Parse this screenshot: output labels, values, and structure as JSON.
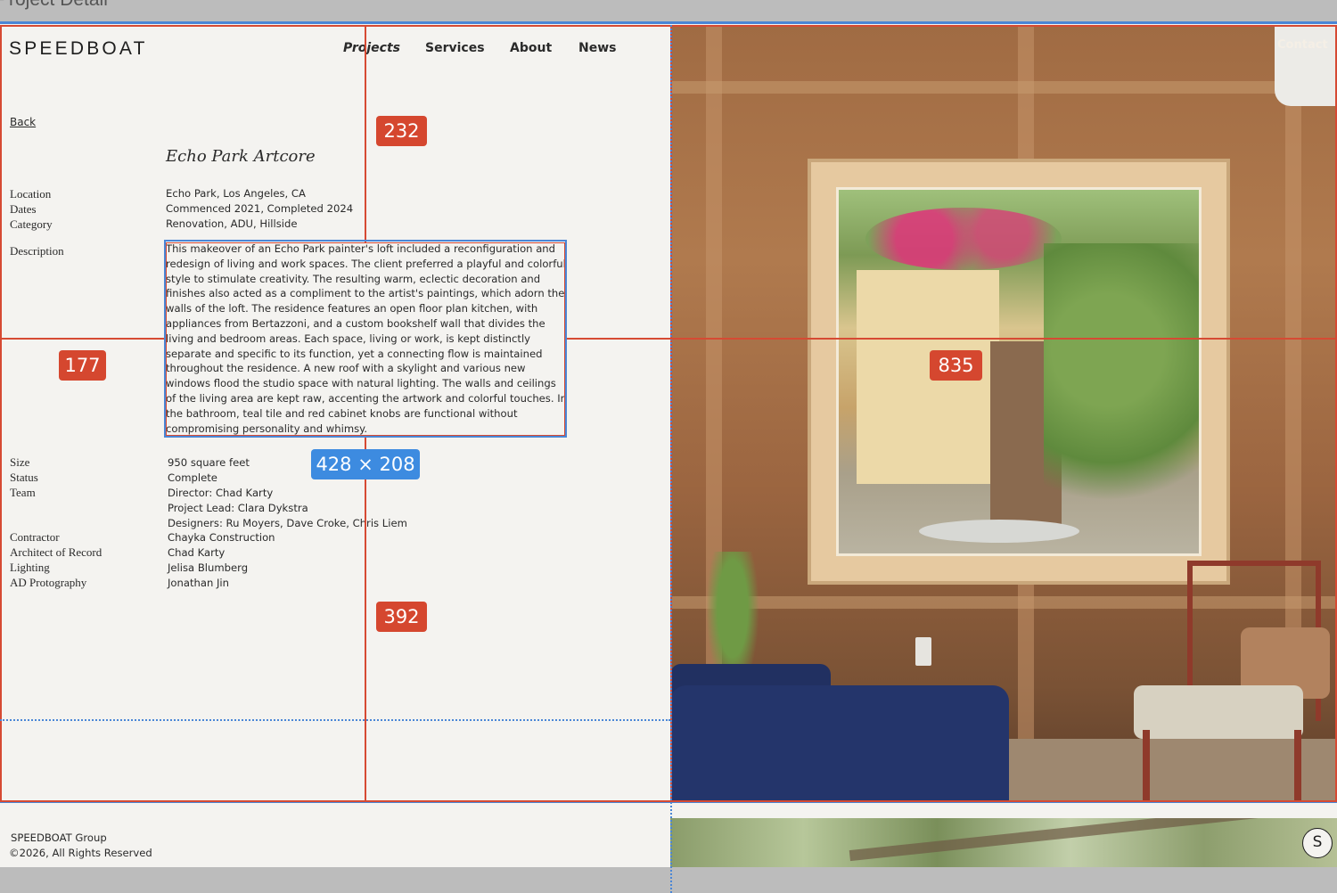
{
  "window": {
    "title": "Project Detail"
  },
  "brand": {
    "logo": "SPEEDBOAT"
  },
  "nav": {
    "projects": "Projects",
    "services": "Services",
    "about": "About",
    "news": "News",
    "contact": "Contact"
  },
  "project": {
    "back": "Back",
    "title": "Echo Park Artcore",
    "labels": {
      "location": "Location",
      "dates": "Dates",
      "category": "Category",
      "description": "Description",
      "size": "Size",
      "status": "Status",
      "team": "Team",
      "contractor": "Contractor",
      "architect": "Architect of Record",
      "lighting": "Lighting",
      "photography": "AD Protography"
    },
    "values": {
      "location": "Echo Park, Los Angeles, CA",
      "dates": "Commenced 2021, Completed 2024",
      "category": "Renovation, ADU, Hillside",
      "size": "950 square feet",
      "status": "Complete",
      "team": [
        "Director: Chad Karty",
        "Project Lead: Clara Dykstra",
        "Designers: Ru Moyers, Dave Croke, Chris Liem"
      ],
      "contractor": "Chayka Construction",
      "architect": "Chad Karty",
      "lighting": "Jelisa Blumberg",
      "photography": "Jonathan Jin"
    },
    "description_lines": [
      "This makeover of an Echo Park painter's loft included a reconfiguration and",
      "redesign of living and work spaces. The client preferred a playful and colorful",
      "style to stimulate creativity. The resulting warm, eclectic decoration and",
      "finishes also acted as a compliment to the artist's paintings, which adorn the",
      "walls of the loft. The residence features an open floor plan kitchen, with",
      "appliances from Bertazzoni, and a custom bookshelf wall that divides the",
      "living and bedroom areas. Each space, living or work, is kept distinctly",
      "separate and specific to its function, yet a connecting flow is maintained",
      "throughout the residence. A new roof with a skylight and various new",
      "windows flood the studio space with natural lighting. The walls and ceilings",
      "of the living area are kept raw, accenting the artwork and colorful touches. In",
      "the bathroom, teal tile and red cabinet knobs are functional without",
      "compromising personality and whimsy."
    ]
  },
  "footer": {
    "company": "SPEEDBOAT Group",
    "copyright": "©2026, All Rights Reserved",
    "badge": "S"
  },
  "inspector": {
    "top_distance": "232",
    "left_distance": "177",
    "right_distance": "835",
    "bottom_distance": "392",
    "selection_size": "428 × 208"
  },
  "colors": {
    "measure_red": "#d5472f",
    "measure_blue": "#3d8be0",
    "page_bg": "#f4f3f0"
  }
}
